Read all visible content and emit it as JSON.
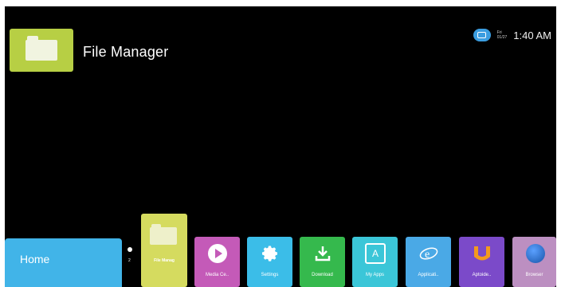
{
  "app": {
    "title": "File Manager",
    "icon": "folder-icon"
  },
  "status_bar": {
    "network_icon": "network-icon",
    "date": "Fri\n01/27",
    "time": "1:40 AM"
  },
  "home": {
    "label": "Home",
    "page_count": "2"
  },
  "featured": {
    "label": "File Manag"
  },
  "apps": [
    {
      "label": "Media Ce..",
      "icon": "play-icon",
      "color": "#c45ab8"
    },
    {
      "label": "Settings",
      "icon": "gear-icon",
      "color": "#3bbde8"
    },
    {
      "label": "Download",
      "icon": "download-icon",
      "color": "#35b94d"
    },
    {
      "label": "My Apps",
      "icon": "apps-icon",
      "color": "#3bc6d8"
    },
    {
      "label": "Applicati..",
      "icon": "application-icon",
      "color": "#4aa9e6"
    },
    {
      "label": "Aptoide..",
      "icon": "aptoide-icon",
      "color": "#7b4ac9"
    },
    {
      "label": "Browser",
      "icon": "globe-icon",
      "color": "#bc8fc1"
    }
  ]
}
